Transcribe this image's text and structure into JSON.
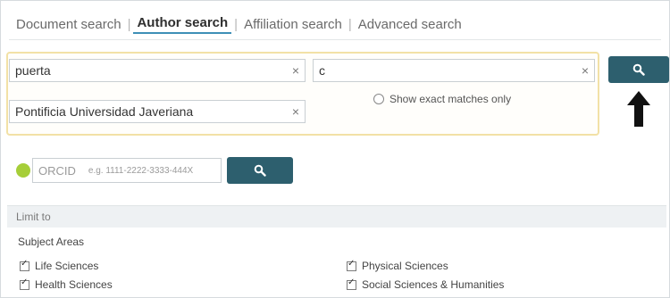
{
  "tabs": [
    {
      "label": "Document search"
    },
    {
      "label": "Author search"
    },
    {
      "label": "Affiliation search"
    },
    {
      "label": "Advanced search"
    }
  ],
  "author_form": {
    "last_name_value": "puerta",
    "first_name_value": "c",
    "affiliation_value": "Pontificia Universidad Javeriana",
    "exact_matches_label": "Show exact matches only",
    "search_icon": "search-icon",
    "annotation_icon": "up-arrow-icon"
  },
  "orcid": {
    "placeholder_label": "ORCID",
    "placeholder_example": "e.g. 1111-2222-3333-444X",
    "search_icon": "search-icon"
  },
  "limit": {
    "label": "Limit to",
    "subject_areas_title": "Subject Areas",
    "subject_areas": [
      {
        "label": "Life Sciences",
        "checked": true
      },
      {
        "label": "Health Sciences",
        "checked": true
      },
      {
        "label": "Physical Sciences",
        "checked": true
      },
      {
        "label": "Social Sciences & Humanities",
        "checked": true
      }
    ]
  },
  "colors": {
    "button": "#2d5f6e",
    "active_tab_underline": "#3d8fb6",
    "group_border": "#f2e1a6",
    "orcid_green": "#a6ce39"
  }
}
